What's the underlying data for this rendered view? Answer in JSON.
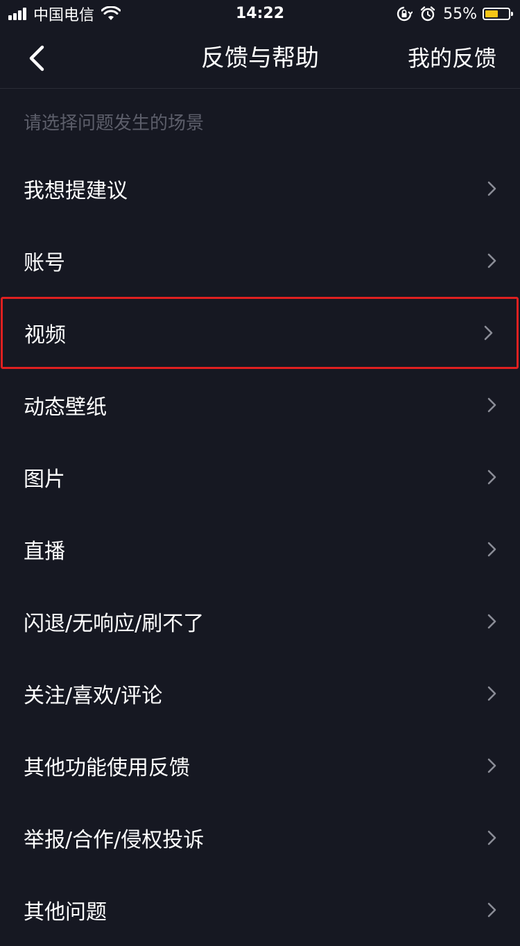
{
  "status_bar": {
    "carrier": "中国电信",
    "time": "14:22",
    "battery_percent_text": "55%",
    "battery_level": 0.55,
    "battery_color": "#f5c518"
  },
  "nav": {
    "back_icon": "chevron-left-icon",
    "title": "反馈与帮助",
    "my_feedback": "我的反馈"
  },
  "section_hint": "请选择问题发生的场景",
  "items": [
    {
      "label": "我想提建议"
    },
    {
      "label": "账号"
    },
    {
      "label": "视频"
    },
    {
      "label": "动态壁纸"
    },
    {
      "label": "图片"
    },
    {
      "label": "直播"
    },
    {
      "label": "闪退/无响应/刷不了"
    },
    {
      "label": "关注/喜欢/评论"
    },
    {
      "label": "其他功能使用反馈"
    },
    {
      "label": "举报/合作/侵权投诉"
    },
    {
      "label": "其他问题"
    }
  ],
  "highlight_color": "#e02020",
  "background_color": "#161822"
}
